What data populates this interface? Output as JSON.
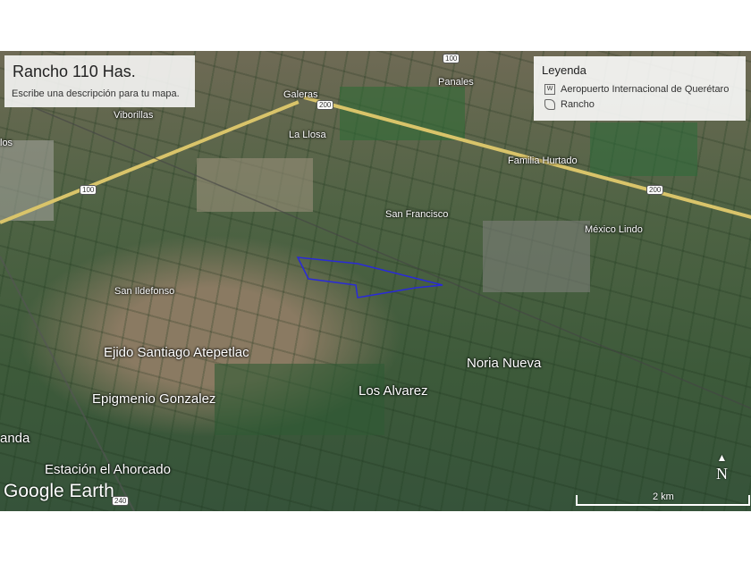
{
  "title": {
    "name": "Rancho 110 Has.",
    "description": "Escribe una descripción para tu mapa."
  },
  "legend": {
    "heading": "Leyenda",
    "items": [
      {
        "icon": "wikipedia-icon",
        "label": "Aeropuerto Internacional de Querétaro"
      },
      {
        "icon": "polygon-icon",
        "label": "Rancho"
      }
    ]
  },
  "places": [
    "Panales",
    "Galeras",
    "Viborillas",
    "La Llosa",
    "Familia Hurtado",
    "San Francisco",
    "México Lindo",
    "San Ildefonso",
    "Ejido Santiago Atepetlac",
    "Noria Nueva",
    "Epigmenio Gonzalez",
    "Los Alvarez",
    "anda",
    "Estación el Ahorcado",
    "los"
  ],
  "roads": [
    "100",
    "200",
    "100",
    "200",
    "240"
  ],
  "scale": "2 km",
  "north": "N",
  "logo": "Google Earth",
  "colors": {
    "boundary": "#2a2ad8",
    "road": "#d9c46a"
  }
}
